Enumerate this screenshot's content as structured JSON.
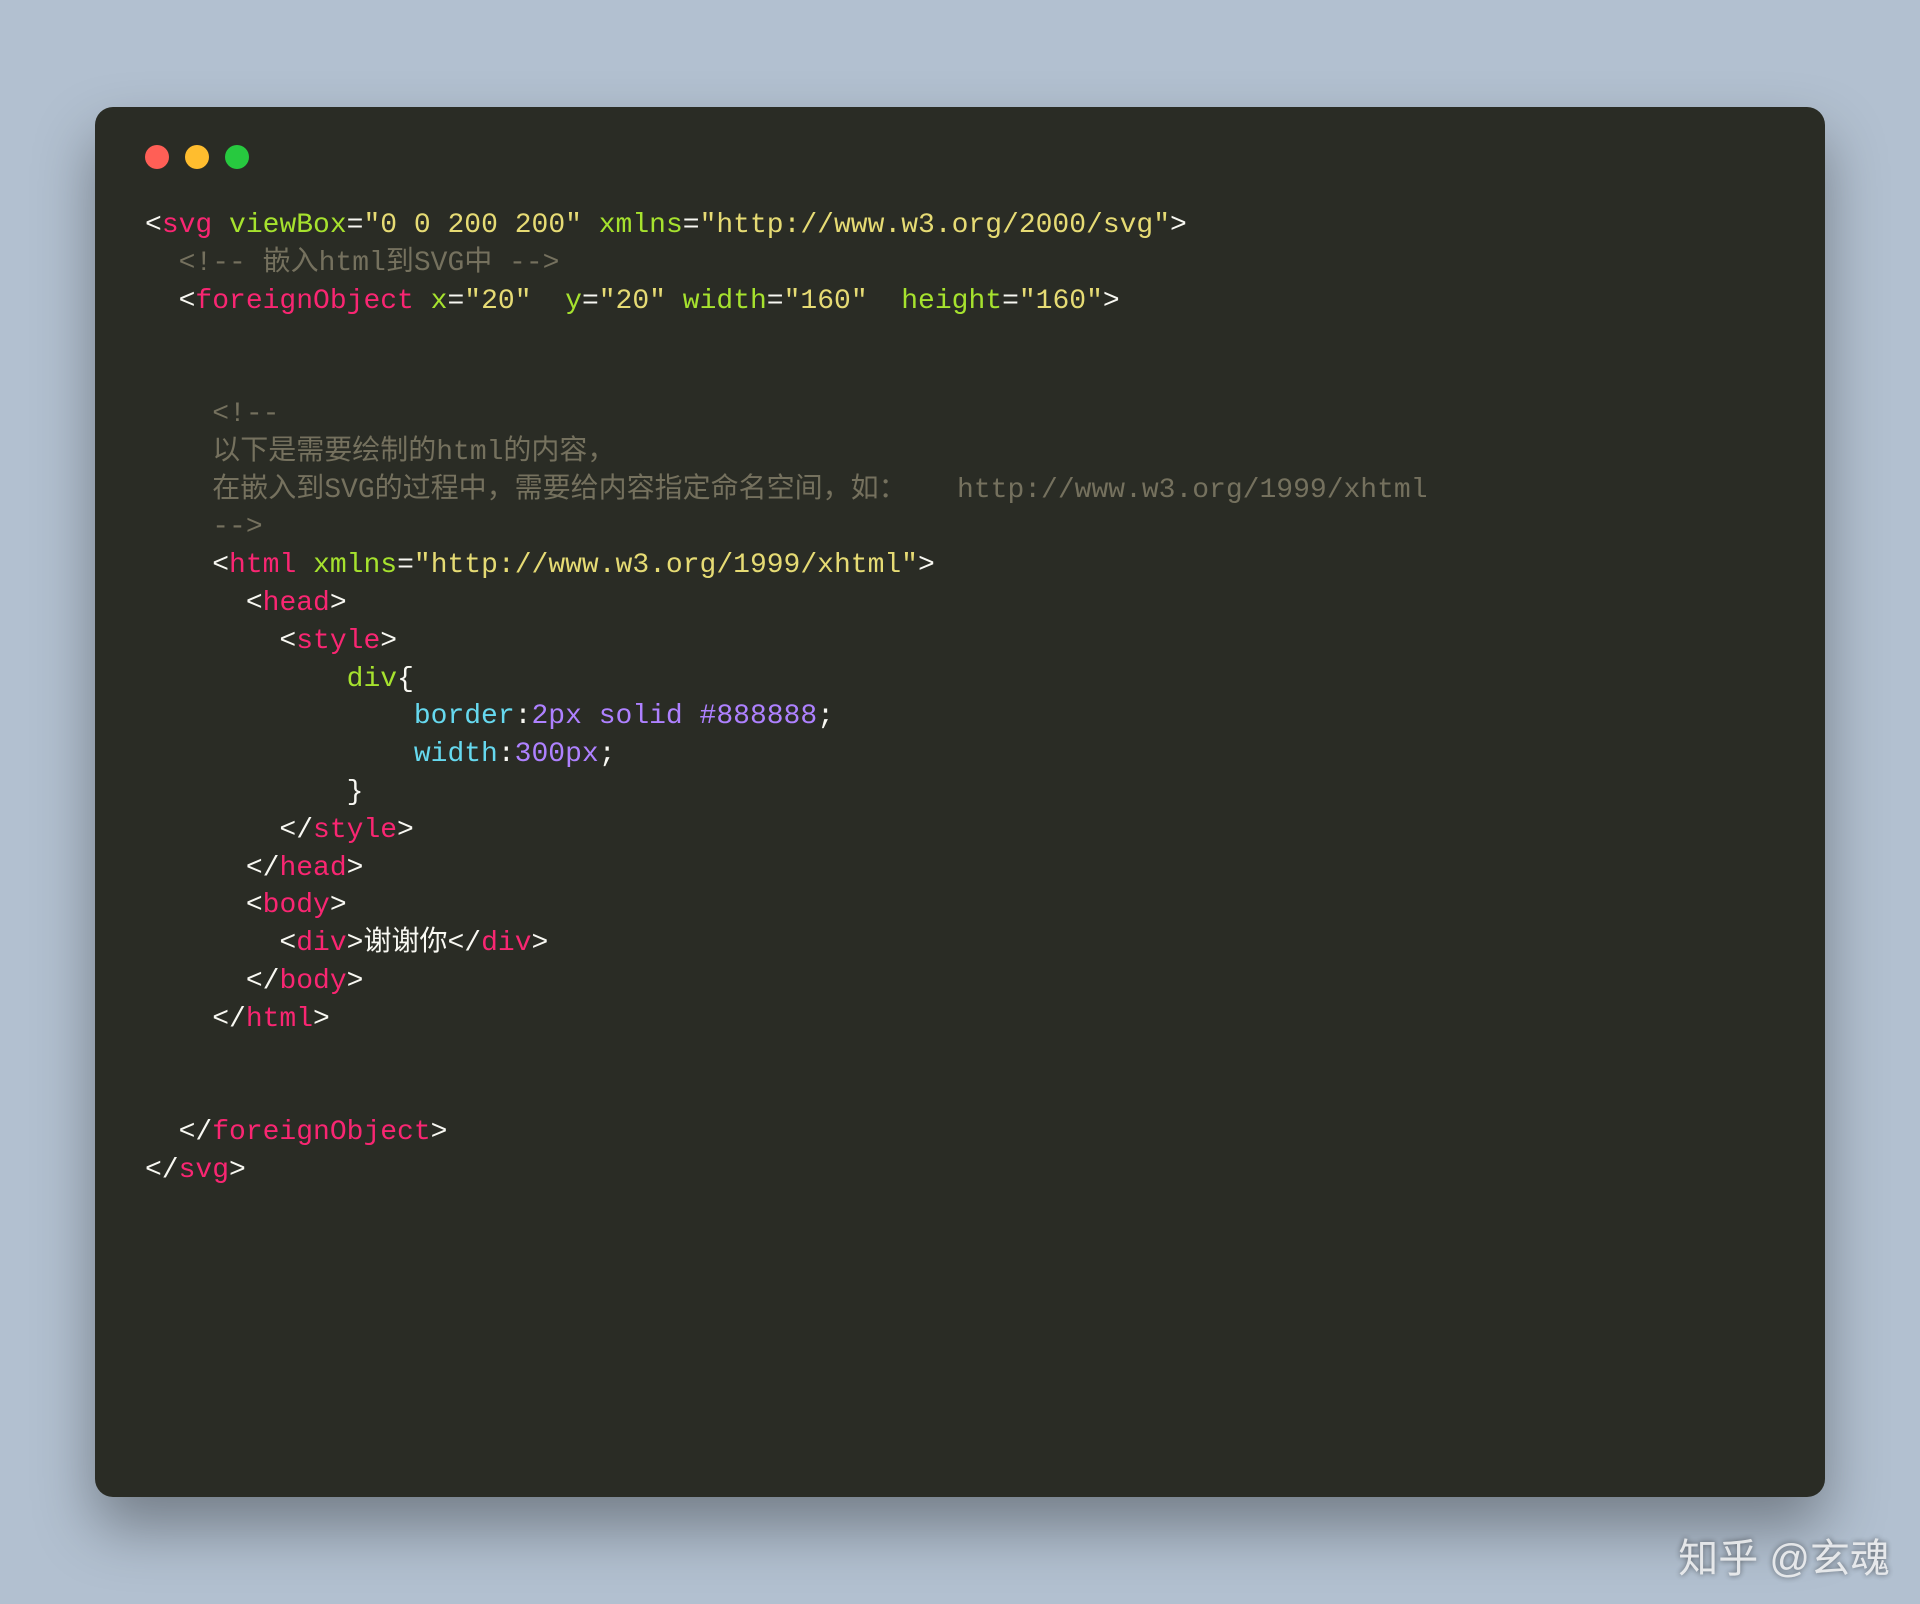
{
  "code": {
    "l1": {
      "open_bracket": "<",
      "tag": "svg",
      "sp": " ",
      "attr1": "viewBox",
      "eq": "=",
      "val1": "\"0 0 200 200\"",
      "sp2": " ",
      "attr2": "xmlns",
      "val2": "\"http://www.w3.org/2000/svg\"",
      "close_bracket": ">"
    },
    "l2": {
      "indent": "  ",
      "comment": "<!-- 嵌入html到SVG中 -->"
    },
    "l3": {
      "indent": "  ",
      "open_bracket": "<",
      "tag": "foreignObject",
      "sp": " ",
      "attr1": "x",
      "eq": "=",
      "val1": "\"20\"",
      "sp2": "  ",
      "attr2": "y",
      "val2": "\"20\"",
      "sp3": " ",
      "attr3": "width",
      "val3": "\"160\"",
      "sp4": "  ",
      "attr4": "height",
      "val4": "\"160\"",
      "close_bracket": ">"
    },
    "l4": {
      "blank": ""
    },
    "l5": {
      "blank": ""
    },
    "l6": {
      "indent": "    ",
      "comment_open": "<!--"
    },
    "l7": {
      "indent": "    ",
      "comment_text": "以下是需要绘制的html的内容，"
    },
    "l8": {
      "indent": "    ",
      "comment_text": "在嵌入到SVG的过程中，需要给内容指定命名空间，如：   http://www.w3.org/1999/xhtml"
    },
    "l9": {
      "indent": "    ",
      "comment_close": "-->"
    },
    "l10": {
      "indent": "    ",
      "open_bracket": "<",
      "tag": "html",
      "sp": " ",
      "attr1": "xmlns",
      "eq": "=",
      "val1": "\"http://www.w3.org/1999/xhtml\"",
      "close_bracket": ">"
    },
    "l11": {
      "indent": "      ",
      "open_bracket": "<",
      "tag": "head",
      "close_bracket": ">"
    },
    "l12": {
      "indent": "        ",
      "open_bracket": "<",
      "tag": "style",
      "close_bracket": ">"
    },
    "l13": {
      "indent": "            ",
      "selector": "div",
      "brace": "{"
    },
    "l14": {
      "indent": "                ",
      "property": "border",
      "colon": ":",
      "value": "2px",
      "sp": " ",
      "value2": "solid",
      "sp2": " ",
      "value3": "#888888",
      "semi": ";"
    },
    "l15": {
      "indent": "                ",
      "property": "width",
      "colon": ":",
      "value": "300px",
      "semi": ";"
    },
    "l16": {
      "indent": "            ",
      "brace": "}"
    },
    "l17": {
      "indent": "        ",
      "open_bracket": "</",
      "tag": "style",
      "close_bracket": ">"
    },
    "l18": {
      "indent": "      ",
      "open_bracket": "</",
      "tag": "head",
      "close_bracket": ">"
    },
    "l19": {
      "indent": "      ",
      "open_bracket": "<",
      "tag": "body",
      "close_bracket": ">"
    },
    "l20": {
      "indent": "        ",
      "open_bracket": "<",
      "tag": "div",
      "close_bracket": ">",
      "text": "谢谢你",
      "open_bracket2": "</",
      "tag2": "div",
      "close_bracket2": ">"
    },
    "l21": {
      "indent": "      ",
      "open_bracket": "</",
      "tag": "body",
      "close_bracket": ">"
    },
    "l22": {
      "indent": "    ",
      "open_bracket": "</",
      "tag": "html",
      "close_bracket": ">"
    },
    "l23": {
      "blank": ""
    },
    "l24": {
      "blank": ""
    },
    "l25": {
      "indent": "  ",
      "open_bracket": "</",
      "tag": "foreignObject",
      "close_bracket": ">"
    },
    "l26": {
      "open_bracket": "</",
      "tag": "svg",
      "close_bracket": ">"
    }
  },
  "watermark": "知乎 @玄魂"
}
